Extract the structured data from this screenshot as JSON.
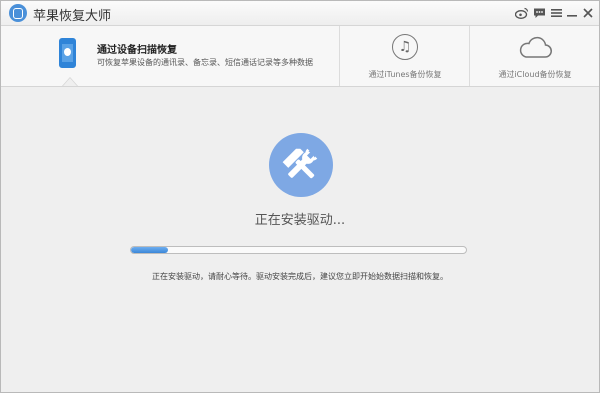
{
  "window": {
    "title": "苹果恢复大师",
    "titlebar_icons": [
      "weibo-icon",
      "chat-icon",
      "menu-icon",
      "minimize-icon",
      "close-icon"
    ]
  },
  "tabs": {
    "device": {
      "title": "通过设备扫描恢复",
      "description": "可恢复苹果设备的通讯录、备忘录、短信通话记录等多种数据",
      "icon": "phone-icon",
      "active": true
    },
    "itunes": {
      "label": "通过iTunes备份恢复",
      "icon": "music-note-icon"
    },
    "icloud": {
      "label": "通过iCloud备份恢复",
      "icon": "cloud-icon"
    }
  },
  "main": {
    "icon": "tools-icon",
    "status": "正在安装驱动...",
    "progress": 0.11,
    "hint": "正在安装驱动，请耐心等待。驱动安装完成后，建议您立即开始始数据扫描和恢复。"
  },
  "colors": {
    "accent": "#2f84d8",
    "tool_circle": "#7ea8e4"
  }
}
